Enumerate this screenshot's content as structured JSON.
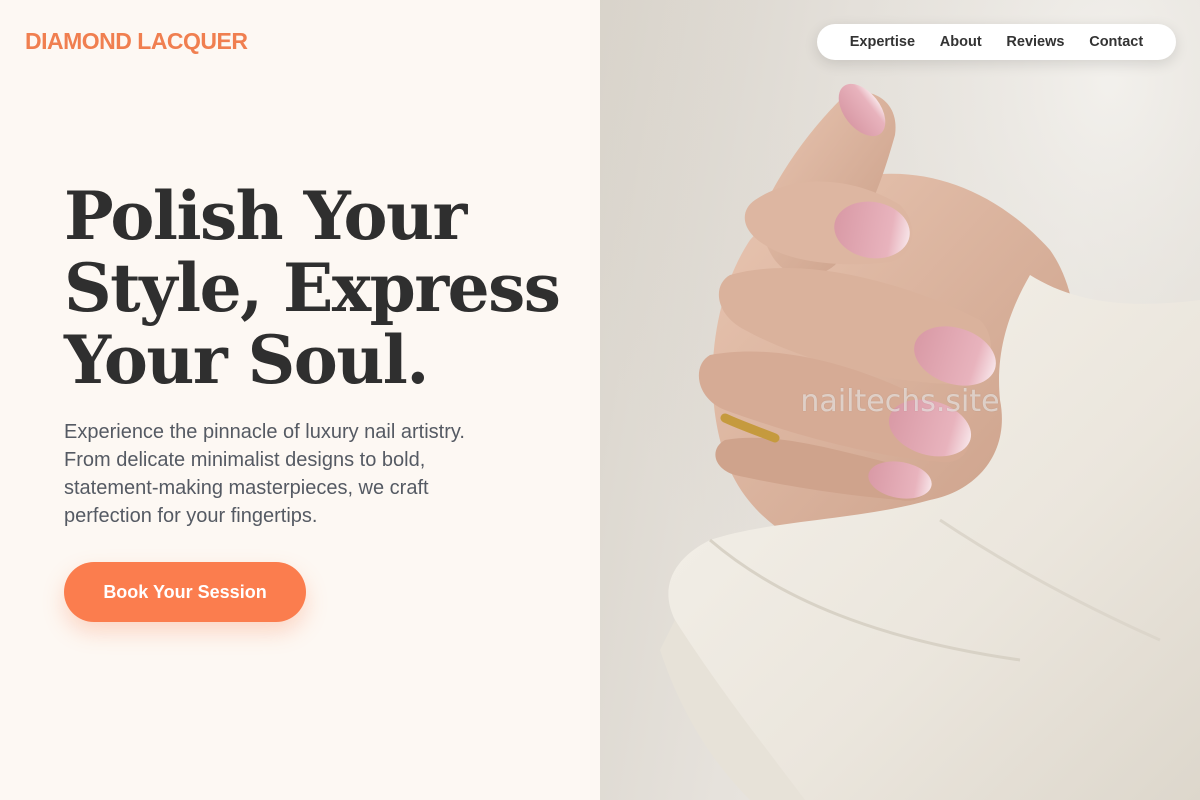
{
  "brand": {
    "logo_text": "DIAMOND LACQUER",
    "accent_color": "#fb7d4e"
  },
  "nav": {
    "items": [
      {
        "label": "Expertise"
      },
      {
        "label": "About"
      },
      {
        "label": "Reviews"
      },
      {
        "label": "Contact"
      }
    ]
  },
  "hero": {
    "title_lines": [
      "Polish Your",
      "Style, Express",
      "Your Soul."
    ],
    "description_lines": [
      "Experience the pinnacle of luxury nail artistry.",
      "From delicate minimalist designs to bold,",
      "statement-making masterpieces, we craft",
      "perfection for your fingertips."
    ],
    "cta_label": "Book Your Session"
  },
  "image": {
    "subject": "hand-with-pink-nails-photo",
    "watermark_text": "nailtechs.site"
  }
}
